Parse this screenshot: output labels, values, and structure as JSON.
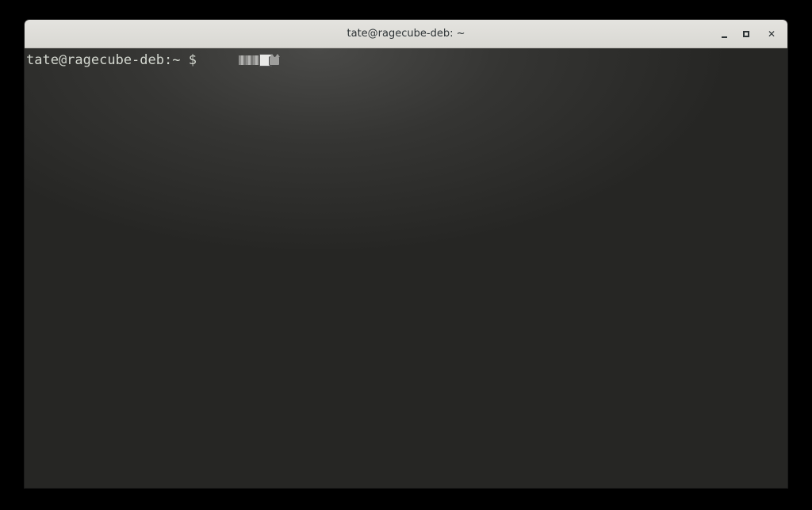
{
  "window": {
    "title": "tate@ragecube-deb: ~",
    "controls": {
      "minimize_icon": "minimize-icon",
      "maximize_icon": "maximize-icon",
      "close_label": "✕"
    }
  },
  "terminal": {
    "prompt": "tate@ragecube-deb:~ $ ",
    "running_program_icon": "nyan-cat-icon"
  },
  "colors": {
    "titlebar": "#dcdbd6",
    "terminal_bg": "#2a2a28",
    "terminal_text": "#d3d7cf"
  }
}
